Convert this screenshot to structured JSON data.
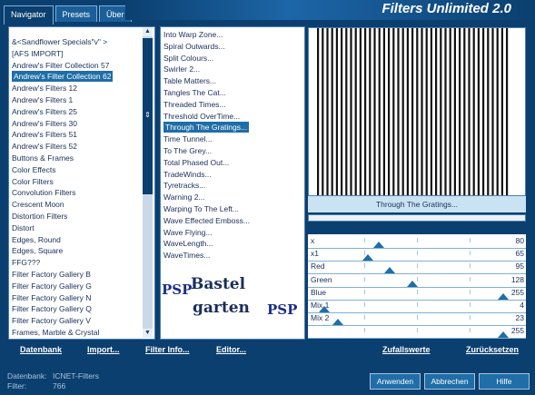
{
  "tabs": [
    "Navigator",
    "Presets",
    "Über"
  ],
  "app_title": "Filters Unlimited 2.0",
  "categories": [
    "&<Sandflower Specials\"v\" >",
    "[AFS IMPORT]",
    "Andrew's Filter Collection 57",
    "Andrew's Filter Collection 62",
    "Andrew's Filters 12",
    "Andrew's Filters 1",
    "Andrew's Filters 25",
    "Andrew's Filters 30",
    "Andrew's Filters 51",
    "Andrew's Filters 52",
    "Buttons & Frames",
    "Color Effects",
    "Color Filters",
    "Convolution Filters",
    "Crescent Moon",
    "Distortion Filters",
    "Distort",
    "Edges, Round",
    "Edges, Square",
    "FFG???",
    "Filter Factory Gallery B",
    "Filter Factory Gallery G",
    "Filter Factory Gallery N",
    "Filter Factory Gallery Q",
    "Filter Factory Gallery V",
    "Frames, Marble & Crystal"
  ],
  "selected_category_index": 3,
  "filters": [
    "Into Warp Zone...",
    "Spiral Outwards...",
    "Split Colours...",
    "Swirler 2...",
    "Table Matters...",
    "Tangles The Cat...",
    "Threaded Times...",
    "Threshold OverTime...",
    "Through The Gratings...",
    "Time Tunnel...",
    "To The Grey...",
    "Total Phased Out...",
    "TradeWinds...",
    "Tyretracks...",
    "Warning 2...",
    "Warping To The Left...",
    "Wave Effected Emboss...",
    "Wave Flying...",
    "WaveLength...",
    "WaveTimes..."
  ],
  "selected_filter_index": 8,
  "preview_label": "Through The Gratings...",
  "logo": {
    "line1": "Bastel",
    "line2": "garten",
    "badge": "PSP"
  },
  "sliders": [
    {
      "name": "x",
      "value": "80",
      "level": 0.314
    },
    {
      "name": "x1",
      "value": "65",
      "level": 0.255
    },
    {
      "name": "Red",
      "value": "95",
      "level": 0.373
    },
    {
      "name": "Green",
      "value": "128",
      "level": 0.502
    },
    {
      "name": "Blue",
      "value": "255",
      "level": 1.0
    },
    {
      "name": "Mix 1",
      "value": "4",
      "level": 0.016
    },
    {
      "name": "Mix 2",
      "value": "23",
      "level": 0.09
    },
    {
      "name": "",
      "value": "255",
      "level": 1.0
    }
  ],
  "bottom_links": {
    "database": "Datenbank",
    "import": "Import...",
    "filter_info": "Filter Info...",
    "editor": "Editor...",
    "random": "Zufallswerte",
    "reset": "Zurücksetzen"
  },
  "status": {
    "db_label": "Datenbank:",
    "db_value": "ICNET-Filters",
    "filter_label": "Filter:",
    "filter_value": "766"
  },
  "buttons": {
    "apply": "Anwenden",
    "cancel": "Abbrechen",
    "help": "Hilfe"
  }
}
